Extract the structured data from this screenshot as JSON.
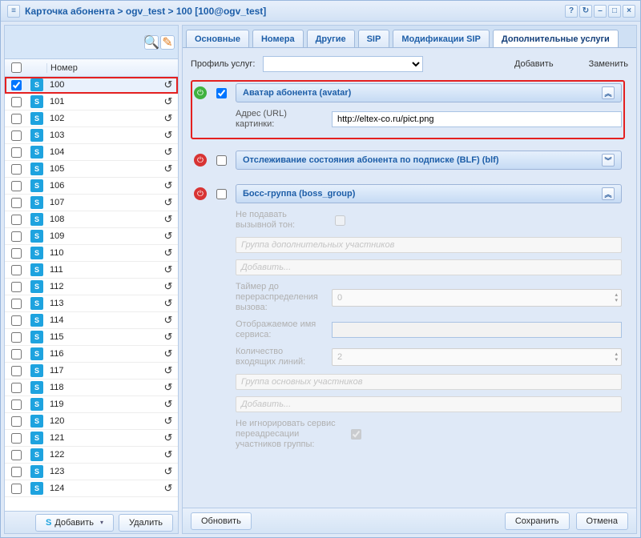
{
  "window": {
    "title": "Карточка абонента > ogv_test > 100 [100@ogv_test]"
  },
  "grid": {
    "header_number": "Номер",
    "rows": [
      {
        "num": "100",
        "checked": true,
        "highlight": true
      },
      {
        "num": "101"
      },
      {
        "num": "102"
      },
      {
        "num": "103"
      },
      {
        "num": "104"
      },
      {
        "num": "105"
      },
      {
        "num": "106"
      },
      {
        "num": "107"
      },
      {
        "num": "108"
      },
      {
        "num": "109"
      },
      {
        "num": "110"
      },
      {
        "num": "111"
      },
      {
        "num": "112"
      },
      {
        "num": "113"
      },
      {
        "num": "114"
      },
      {
        "num": "115"
      },
      {
        "num": "116"
      },
      {
        "num": "117"
      },
      {
        "num": "118"
      },
      {
        "num": "119"
      },
      {
        "num": "120"
      },
      {
        "num": "121"
      },
      {
        "num": "122"
      },
      {
        "num": "123"
      },
      {
        "num": "124"
      }
    ],
    "sip_glyph": "S"
  },
  "left_footer": {
    "add": "Добавить",
    "delete": "Удалить"
  },
  "tabs": {
    "main": "Основные",
    "numbers": "Номера",
    "other": "Другие",
    "sip": "SIP",
    "sipmod": "Модификации SIP",
    "extras": "Дополнительные услуги"
  },
  "profile": {
    "label": "Профиль услуг:",
    "add": "Добавить",
    "replace": "Заменить"
  },
  "services": {
    "avatar": {
      "title": "Аватар абонента (avatar)",
      "url_label": "Адрес (URL) картинки:",
      "url_value": "http://eltex-co.ru/pict.png"
    },
    "blf": {
      "title": "Отслеживание состояния абонента по подписке (BLF) (blf)"
    },
    "boss": {
      "title": "Босс-группа (boss_group)",
      "no_tone": "Не подавать вызывной тон:",
      "extra_group": "Группа дополнительных участников",
      "add": "Добавить...",
      "timer": "Таймер до перераспределения вызова:",
      "timer_val": "0",
      "display_name": "Отображаемое имя сервиса:",
      "lines": "Количество входящих линий:",
      "lines_val": "2",
      "main_group": "Группа основных участников",
      "ignore": "Не игнорировать сервис переадресации участников группы:"
    }
  },
  "footer": {
    "refresh": "Обновить",
    "save": "Сохранить",
    "cancel": "Отмена"
  }
}
